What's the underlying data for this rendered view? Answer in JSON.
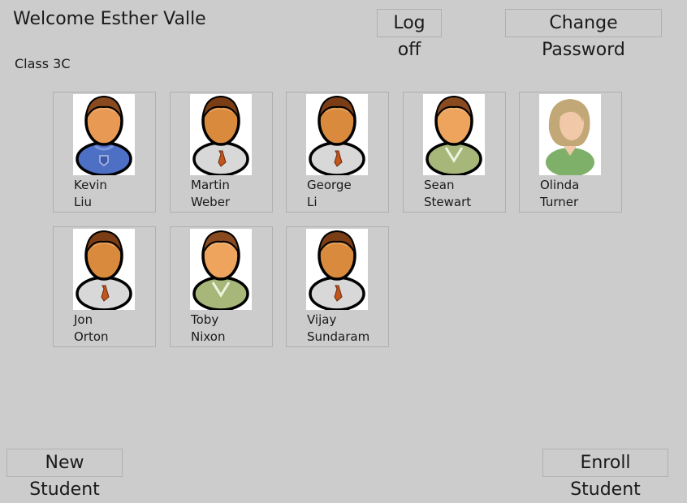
{
  "header": {
    "welcome": "Welcome Esther Valle",
    "logoff_label": "Log off",
    "change_password_label": "Change Password"
  },
  "class_name": "Class 3C",
  "students": [
    {
      "first": "Kevin",
      "last": "Liu",
      "icon": "male-student-blue-sweater-icon",
      "shirt": "#4d6fc4",
      "skin": "#e89a55",
      "hair": "#8a4a1f",
      "tie": false
    },
    {
      "first": "Martin",
      "last": "Weber",
      "icon": "male-student-tie-icon",
      "shirt": "#d8d8d8",
      "skin": "#d98a3c",
      "hair": "#7a3d15",
      "tie": true
    },
    {
      "first": "George",
      "last": "Li",
      "icon": "male-student-tie-icon",
      "shirt": "#d8d8d8",
      "skin": "#d98a3c",
      "hair": "#7a3d15",
      "tie": true
    },
    {
      "first": "Sean",
      "last": "Stewart",
      "icon": "male-student-green-shirt-icon",
      "shirt": "#a7b77a",
      "skin": "#eea45c",
      "hair": "#8a4a1f",
      "tie": false
    },
    {
      "first": "Olinda",
      "last": "Turner",
      "icon": "female-student-icon",
      "shirt": "#7fb06a",
      "skin": "#f1c9a8",
      "hair": "#c2a877",
      "tie": false
    },
    {
      "first": "Jon",
      "last": "Orton",
      "icon": "male-student-tie-icon",
      "shirt": "#d8d8d8",
      "skin": "#d98a3c",
      "hair": "#7a3d15",
      "tie": true
    },
    {
      "first": "Toby",
      "last": "Nixon",
      "icon": "male-student-green-shirt-icon",
      "shirt": "#a7b77a",
      "skin": "#eea45c",
      "hair": "#8a4a1f",
      "tie": false
    },
    {
      "first": "Vijay",
      "last": "Sundaram",
      "icon": "male-student-tie-icon",
      "shirt": "#d8d8d8",
      "skin": "#d98a3c",
      "hair": "#7a3d15",
      "tie": true
    }
  ],
  "footer": {
    "new_student_label": "New Student",
    "enroll_student_label": "Enroll Student"
  }
}
